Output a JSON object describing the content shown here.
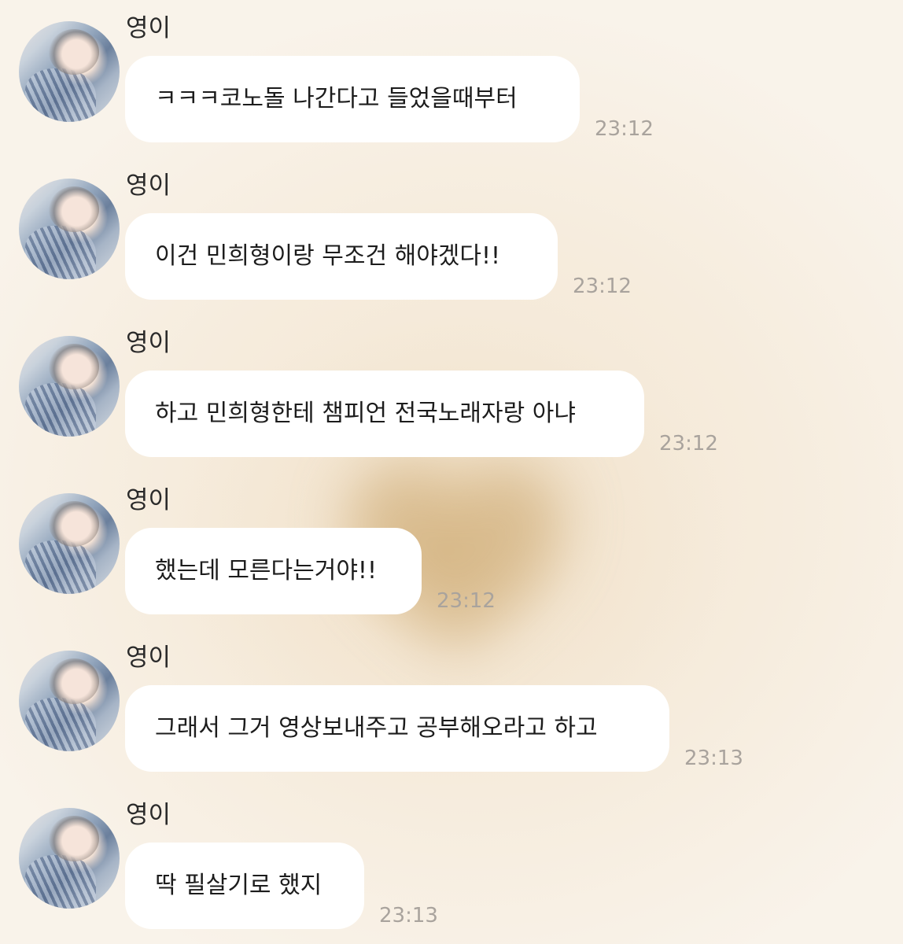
{
  "messages": [
    {
      "sender": "영이",
      "text": "ㅋㅋㅋ코노돌 나간다고 들었을때부터",
      "time": "23:12"
    },
    {
      "sender": "영이",
      "text": "이건 민희형이랑 무조건 해야겠다!!",
      "time": "23:12"
    },
    {
      "sender": "영이",
      "text": "하고 민희형한테 챔피언 전국노래자랑 아냐",
      "time": "23:12"
    },
    {
      "sender": "영이",
      "text": "했는데 모른다는거야!!",
      "time": "23:12"
    },
    {
      "sender": "영이",
      "text": "그래서 그거 영상보내주고 공부해오라고 하고",
      "time": "23:13"
    },
    {
      "sender": "영이",
      "text": "딱 필살기로 했지",
      "time": "23:13"
    }
  ]
}
